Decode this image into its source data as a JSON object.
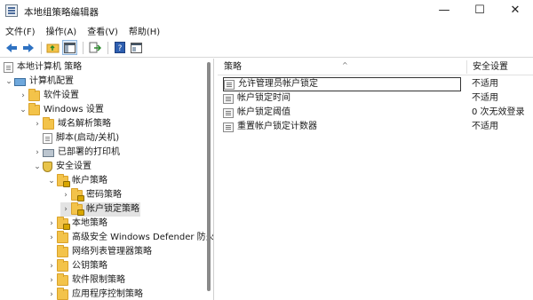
{
  "window": {
    "title": "本地组策略编辑器",
    "minimize_glyph": "—",
    "maximize_glyph": "☐",
    "close_glyph": "✕"
  },
  "menu": [
    "文件(F)",
    "操作(A)",
    "查看(V)",
    "帮助(H)"
  ],
  "toolbar_icons": [
    "back-arrow-icon",
    "forward-arrow-icon",
    "up-folder-icon",
    "show-hide-tree-icon",
    "export-list-icon",
    "help-icon",
    "properties-icon"
  ],
  "tree": {
    "root": "本地计算机 策略",
    "computer_config": "计算机配置",
    "software_settings": "软件设置",
    "windows_settings": "Windows 设置",
    "name_resolution": "域名解析策略",
    "scripts": "脚本(启动/关机)",
    "printers": "已部署的打印机",
    "security_settings": "安全设置",
    "account_policies": "帐户策略",
    "password_policy": "密码策略",
    "lockout_policy": "帐户锁定策略",
    "local_policies": "本地策略",
    "firewall": "高级安全 Windows Defender 防火墙",
    "network_list": "网络列表管理器策略",
    "public_key": "公钥策略",
    "software_restriction": "软件限制策略",
    "app_control": "应用程序控制策略"
  },
  "list": {
    "headers": {
      "policy": "策略",
      "setting": "安全设置"
    },
    "rows": [
      {
        "policy": "允许管理员帐户锁定",
        "setting": "不适用"
      },
      {
        "policy": "帐户锁定时间",
        "setting": "不适用"
      },
      {
        "policy": "帐户锁定阈值",
        "setting": "0 次无效登录"
      },
      {
        "policy": "重置帐户锁定计数器",
        "setting": "不适用"
      }
    ]
  },
  "colors": {
    "accent": "#2e72c2",
    "folder": "#f3c34a",
    "selected": "#e3e3e3"
  }
}
